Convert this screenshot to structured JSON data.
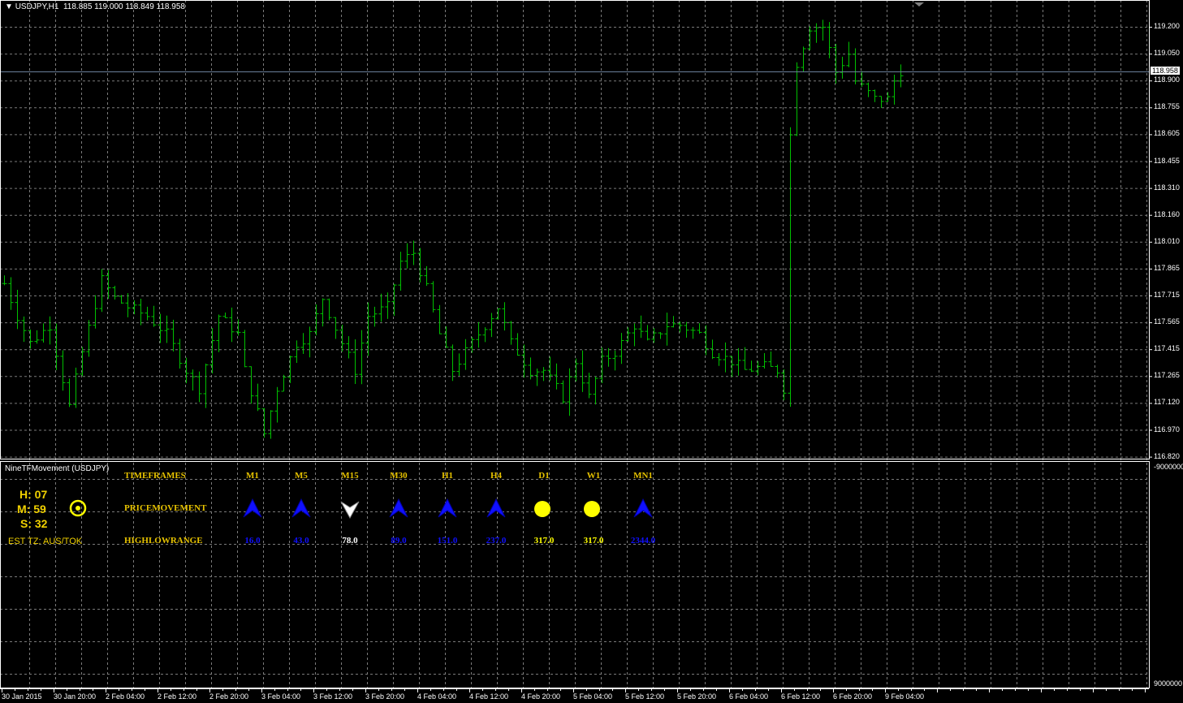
{
  "header": {
    "symbol_tf": "USDJPY,H1",
    "ohlc": "118.885 119.000 118.849 118.958"
  },
  "colors": {
    "bar": "#00c000",
    "grid": "#808080",
    "axis": "#ffffff",
    "gold": "#e6c200",
    "blue": "#1010ff",
    "yellow": "#ffff00",
    "current_line": "#6a7f9a"
  },
  "price_axis": {
    "labels": [
      "119.200",
      "119.050",
      "118.900",
      "118.755",
      "118.605",
      "118.455",
      "118.310",
      "118.160",
      "118.010",
      "117.865",
      "117.715",
      "117.565",
      "117.415",
      "117.265",
      "117.120",
      "116.970",
      "116.820"
    ],
    "current_price": "118.958"
  },
  "time_axis": {
    "labels": [
      "30 Jan 2015",
      "30 Jan 20:00",
      "2 Feb 04:00",
      "2 Feb 12:00",
      "2 Feb 20:00",
      "3 Feb 04:00",
      "3 Feb 12:00",
      "3 Feb 20:00",
      "4 Feb 04:00",
      "4 Feb 12:00",
      "4 Feb 20:00",
      "5 Feb 04:00",
      "5 Feb 12:00",
      "5 Feb 20:00",
      "6 Feb 04:00",
      "6 Feb 12:00",
      "6 Feb 20:00",
      "9 Feb 04:00"
    ]
  },
  "chart_data": {
    "type": "ohlc",
    "ymin": 116.82,
    "ymax": 119.2,
    "bar_count": 139,
    "keypoints": [
      [
        0,
        117.78
      ],
      [
        2,
        117.6
      ],
      [
        4,
        117.45
      ],
      [
        7,
        117.55
      ],
      [
        10,
        117.1
      ],
      [
        12,
        117.4
      ],
      [
        15,
        117.8
      ],
      [
        17,
        117.7
      ],
      [
        19,
        117.65
      ],
      [
        22,
        117.6
      ],
      [
        25,
        117.5
      ],
      [
        28,
        117.3
      ],
      [
        30,
        117.2
      ],
      [
        33,
        117.6
      ],
      [
        36,
        117.5
      ],
      [
        37,
        117.3
      ],
      [
        40,
        116.95
      ],
      [
        42,
        117.2
      ],
      [
        45,
        117.45
      ],
      [
        47,
        117.5
      ],
      [
        49,
        117.7
      ],
      [
        52,
        117.45
      ],
      [
        54,
        117.3
      ],
      [
        56,
        117.6
      ],
      [
        59,
        117.65
      ],
      [
        61,
        117.9
      ],
      [
        63,
        117.95
      ],
      [
        65,
        117.75
      ],
      [
        67,
        117.5
      ],
      [
        69,
        117.3
      ],
      [
        72,
        117.45
      ],
      [
        74,
        117.55
      ],
      [
        76,
        117.65
      ],
      [
        78,
        117.45
      ],
      [
        81,
        117.3
      ],
      [
        83,
        117.3
      ],
      [
        86,
        117.15
      ],
      [
        88,
        117.35
      ],
      [
        90,
        117.15
      ],
      [
        92,
        117.35
      ],
      [
        94,
        117.4
      ],
      [
        97,
        117.55
      ],
      [
        99,
        117.45
      ],
      [
        102,
        117.55
      ],
      [
        104,
        117.55
      ],
      [
        107,
        117.5
      ],
      [
        109,
        117.4
      ],
      [
        112,
        117.35
      ],
      [
        114,
        117.3
      ],
      [
        117,
        117.32
      ],
      [
        119,
        117.3
      ],
      [
        120,
        117.2
      ],
      [
        121,
        118.6
      ],
      [
        122,
        119.0
      ],
      [
        124,
        119.2
      ],
      [
        126,
        119.2
      ],
      [
        128,
        118.95
      ],
      [
        130,
        119.05
      ],
      [
        131,
        118.9
      ],
      [
        134,
        118.8
      ],
      [
        136,
        118.8
      ],
      [
        137,
        118.9
      ],
      [
        138,
        118.958
      ]
    ]
  },
  "indicator": {
    "name": "NineTFMovement (USDJPY)",
    "scale_top": "-9000000",
    "scale_bottom": "9000000",
    "clock": {
      "h": "H: 07",
      "m": "M: 59",
      "s": "S: 32",
      "tz": "EST TZ:  AUS/TOK"
    },
    "row_labels": {
      "timeframes": "TIMEFRAMES",
      "movement": "PRICEMOVEMENT",
      "range": "HIGHLOWRANGE"
    },
    "timeframes": [
      {
        "tf": "M1",
        "dir": "up",
        "range": "16.0",
        "color": "#1010ff"
      },
      {
        "tf": "M5",
        "dir": "up",
        "range": "43.0",
        "color": "#1010ff"
      },
      {
        "tf": "M15",
        "dir": "down",
        "range": "78.0",
        "color": "#ffffff"
      },
      {
        "tf": "M30",
        "dir": "up",
        "range": "89.0",
        "color": "#1010ff"
      },
      {
        "tf": "H1",
        "dir": "up",
        "range": "151.0",
        "color": "#1010ff"
      },
      {
        "tf": "H4",
        "dir": "up",
        "range": "237.0",
        "color": "#1010ff"
      },
      {
        "tf": "D1",
        "dir": "flat",
        "range": "317.0",
        "color": "#ffff00"
      },
      {
        "tf": "W1",
        "dir": "flat",
        "range": "317.0",
        "color": "#ffff00"
      },
      {
        "tf": "MN1",
        "dir": "up",
        "range": "2344.0",
        "color": "#1010ff"
      }
    ]
  }
}
